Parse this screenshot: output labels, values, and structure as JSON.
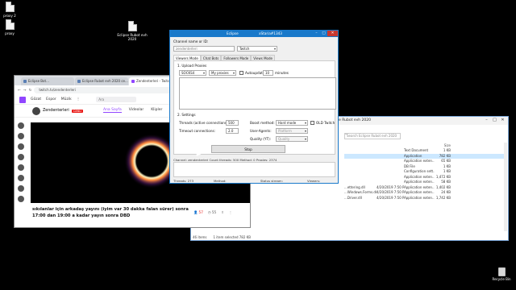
{
  "desktop": {
    "icons": [
      {
        "label": "proxy 2"
      },
      {
        "label": "proxy"
      },
      {
        "label": "Eclipse Rubot evh 2020"
      }
    ],
    "recycle_bin": "Recycle Bin"
  },
  "explorer": {
    "title": "Eclipse Rubot evh 2020",
    "search_placeholder": "Search Eclipse Rubot evh 2020",
    "columns": {
      "size": "Size"
    },
    "rows": [
      {
        "name": "",
        "date": "",
        "type": "Text Document",
        "size": "1 KB"
      },
      {
        "name": "",
        "date": "",
        "type": "Application",
        "size": "782 KB"
      },
      {
        "name": "",
        "date": "",
        "type": "Application exten...",
        "size": "65 KB"
      },
      {
        "name": "",
        "date": "",
        "type": "DB File",
        "size": "1 KB"
      },
      {
        "name": "",
        "date": "",
        "type": "Configuration sett...",
        "size": "1 KB"
      },
      {
        "name": "",
        "date": "",
        "type": "Application exten...",
        "size": "1,472 KB"
      },
      {
        "name": "",
        "date": "",
        "type": "Application exten...",
        "size": "58 KB"
      },
      {
        "name": "...ettering.dll",
        "date": "4/20/2019 7:50 PM",
        "type": "Application exten...",
        "size": "1,402 KB"
      },
      {
        "name": "...Windows.Forms.dll",
        "date": "4/20/2019 7:50 PM",
        "type": "Application exten...",
        "size": "24 KB"
      },
      {
        "name": "...Driver.dll",
        "date": "4/20/2019 7:50 PM",
        "type": "Application exten...",
        "size": "1,742 KB"
      }
    ],
    "network": "Network",
    "status_items": "46 items",
    "status_selected": "1 item selected  782 KB"
  },
  "browser": {
    "tabs": [
      {
        "label": "Eclipse Bot..."
      },
      {
        "label": "Eclipse Rubot evh 2020 ce..."
      },
      {
        "label": "Zendenterleri - Twitch"
      }
    ],
    "url": "twitch.tv/zendenterleri",
    "twitch_nav": {
      "browse": "Gözat",
      "esports": "Espor",
      "music": "Müzik",
      "search_placeholder": "Ara"
    },
    "channel": {
      "name": "Zendenterleri",
      "live_badge": "CANLI"
    },
    "channel_tabs": [
      "Ana Sayfa",
      "Videolar",
      "Klipler",
      "Tak..."
    ],
    "stream_title": "sıkılanlar için arkadaş yayını (iyim var 30 dakka falan sürer) sonra 17:00 dan 19:00 a kadar yayın sonra DBD",
    "viewers": "57",
    "time": "55"
  },
  "eclipse": {
    "title": "Eclipse",
    "subtitle": "xStaria#1343",
    "channel_label": "Channel name or ID:",
    "channel_value": "zendenterleri",
    "platform": "Twitch",
    "tabs": [
      "Viewers Mode",
      "Chat Bots",
      "Followers Mode",
      "Views Mode"
    ],
    "upload_proxies": "1. Upload Proxies",
    "proxy_type": "SOCKS4",
    "proxy_source": "My proxies",
    "autoupdate_label": "Autoupdate",
    "autoupdate_value": "10",
    "minutes": "minutes",
    "settings": "2. Settings",
    "threads_label": "Threads (active connections):",
    "threads_value": "500",
    "timeout_label": "Timeout connections:",
    "timeout_value": "2.0",
    "boost_label": "Boost method:",
    "boost_value": "Hard mode",
    "old_twitch": "OLD Twitch",
    "ua_label": "User-Agents:",
    "ua_value": "Platform",
    "quality_label": "Quality (YT):",
    "quality_value": "Quality",
    "stop_button": "Stop",
    "status_line": "Channel: zendenterleri  Count threads: 500  Method: 0  Proxies: 2374",
    "footer": {
      "threads": "Threads: 273",
      "method": "Method:",
      "status": "Status stream:",
      "viewers": "Viewers:"
    }
  }
}
